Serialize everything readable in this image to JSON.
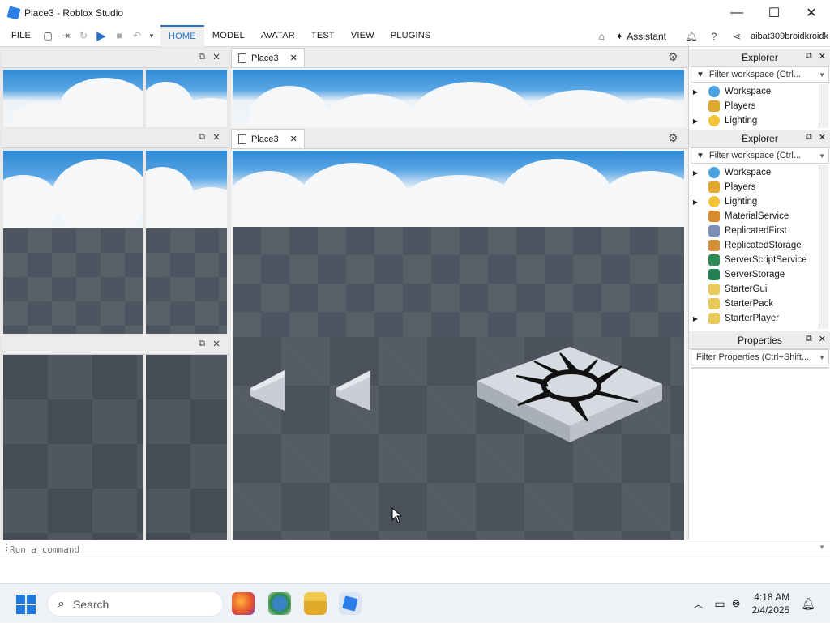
{
  "window": {
    "title": "Place3 - Roblox Studio",
    "minimize": "—",
    "maximize": "☐",
    "close": "✕"
  },
  "menubar": {
    "file": "FILE",
    "tabs": [
      "HOME",
      "MODEL",
      "AVATAR",
      "TEST",
      "VIEW",
      "PLUGINS"
    ],
    "active_tab": "HOME",
    "assistant": "Assistant",
    "username": "aibat309broidkroidk"
  },
  "docs": {
    "tab1": "Place3",
    "tab2": "Place3"
  },
  "explorer1": {
    "title": "Explorer",
    "filter_placeholder": "Filter workspace (Ctrl...",
    "items": [
      "Workspace",
      "Players",
      "Lighting"
    ]
  },
  "explorer2": {
    "title": "Explorer",
    "filter_placeholder": "Filter workspace (Ctrl...",
    "items": [
      "Workspace",
      "Players",
      "Lighting",
      "MaterialService",
      "ReplicatedFirst",
      "ReplicatedStorage",
      "ServerScriptService",
      "ServerStorage",
      "StarterGui",
      "StarterPack",
      "StarterPlayer"
    ]
  },
  "properties": {
    "title": "Properties",
    "filter_placeholder": "Filter Properties (Ctrl+Shift..."
  },
  "command": {
    "placeholder": "Run a command"
  },
  "taskbar": {
    "search": "Search",
    "time": "4:18 AM",
    "date": "2/4/2025"
  },
  "colors": {
    "accent": "#2b6fc9",
    "sky": "#2f8ad6",
    "baseplate": "#4e5560"
  }
}
